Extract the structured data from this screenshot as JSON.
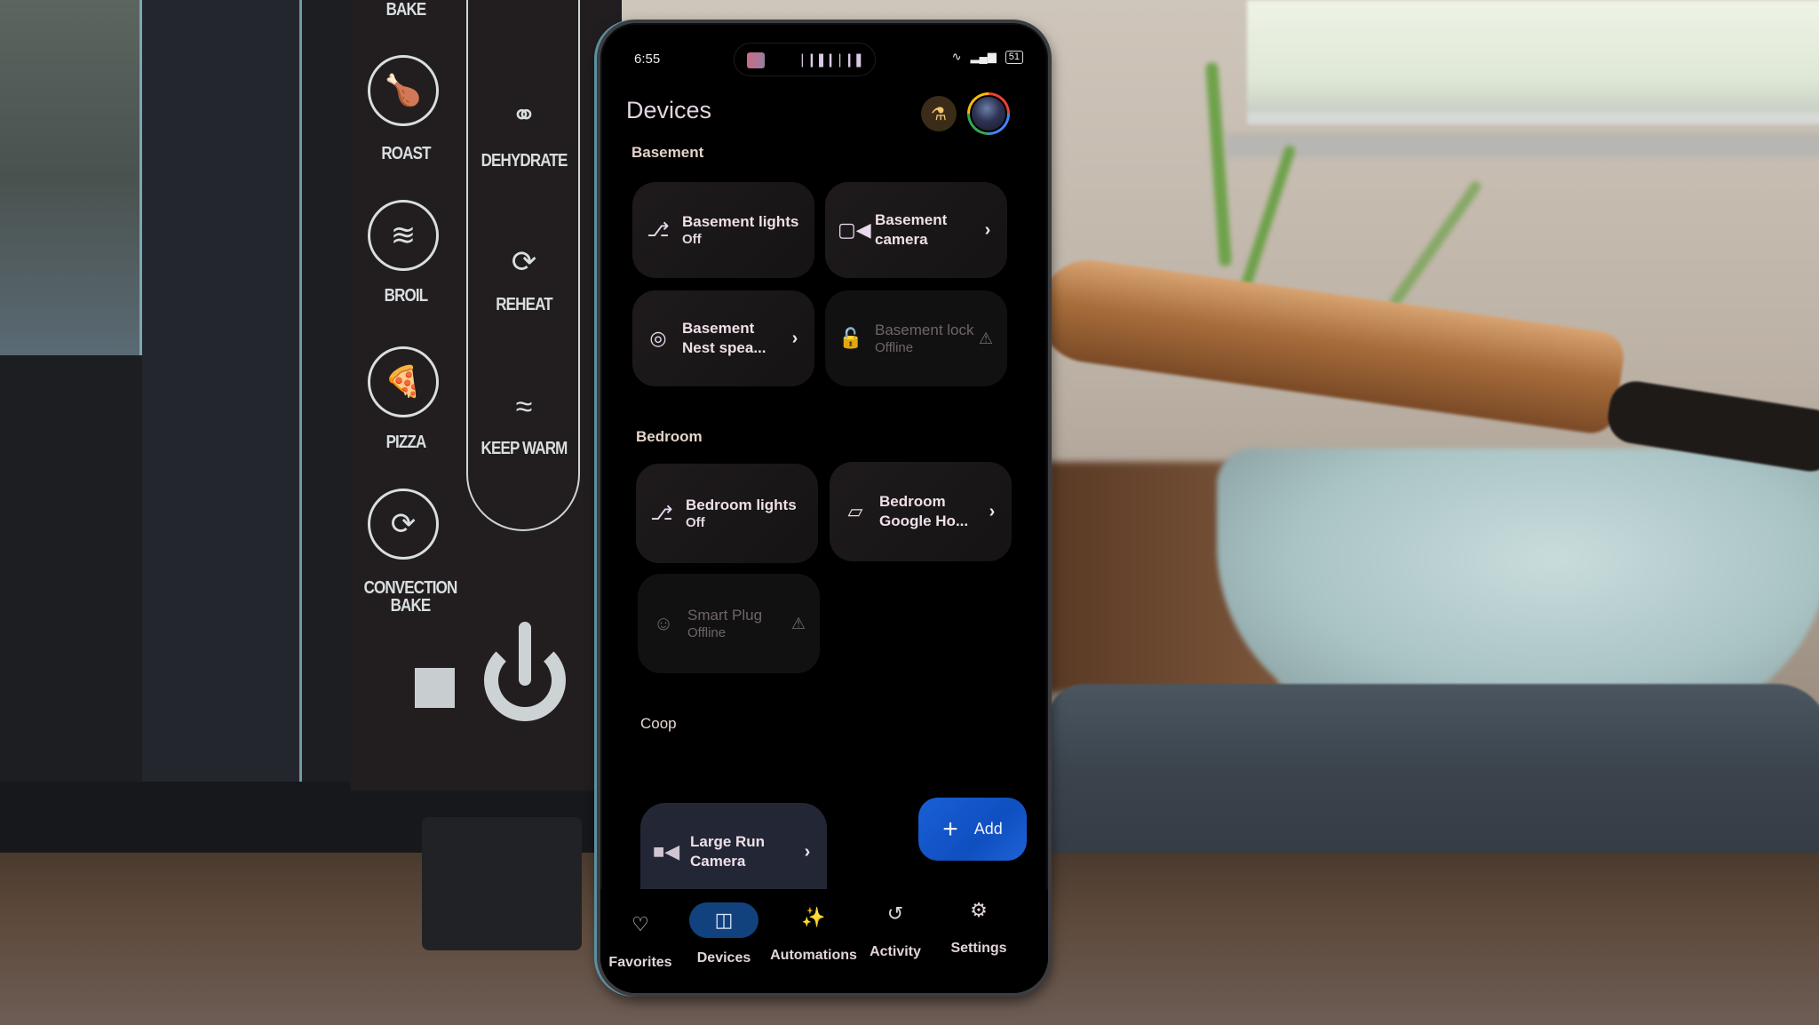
{
  "scene": {
    "oven_panel_labels": [
      "BAKE",
      "ROAST",
      "BROIL",
      "PIZZA",
      "CONVECTION BAKE",
      "DEHYDRATE",
      "REHEAT",
      "KEEP WARM"
    ]
  },
  "status_bar": {
    "time": "6:55",
    "battery": "51",
    "wifi_icon": "wifi-icon",
    "signal_icon": "signal-icon"
  },
  "header": {
    "title": "Devices",
    "labs_icon": "flask-icon",
    "avatar": "account-avatar"
  },
  "sections": [
    {
      "label": "Basement",
      "devices": [
        {
          "name": "Basement lights",
          "status": "Off",
          "icon": "lamp-icon",
          "offline": false,
          "chevron": false
        },
        {
          "name": "Basement camera",
          "status": "",
          "icon": "camera-icon",
          "offline": false,
          "chevron": true
        },
        {
          "name": "Basement Nest spea...",
          "status": "",
          "icon": "speaker-icon",
          "offline": false,
          "chevron": true
        },
        {
          "name": "Basement lock",
          "status": "Offline",
          "icon": "lock-icon",
          "offline": true,
          "chevron": false
        }
      ]
    },
    {
      "label": "Bedroom",
      "devices": [
        {
          "name": "Bedroom lights",
          "status": "Off",
          "icon": "lamp-icon",
          "offline": false,
          "chevron": false
        },
        {
          "name": "Bedroom Google Ho...",
          "status": "",
          "icon": "google-home-speaker-icon",
          "offline": false,
          "chevron": true
        },
        {
          "name": "Smart Plug",
          "status": "Offline",
          "icon": "outlet-icon",
          "offline": true,
          "chevron": false
        }
      ]
    },
    {
      "label": "Coop",
      "devices": [
        {
          "name": "Large Run Camera",
          "status": "",
          "icon": "camera-filled-icon",
          "offline": false,
          "chevron": true
        }
      ]
    }
  ],
  "add_button": {
    "label": "Add",
    "icon": "plus-icon"
  },
  "bottom_nav": [
    {
      "label": "Favorites",
      "icon": "heart-icon",
      "active": false
    },
    {
      "label": "Devices",
      "icon": "devices-icon",
      "active": true
    },
    {
      "label": "Automations",
      "icon": "sparkle-icon",
      "active": false
    },
    {
      "label": "Activity",
      "icon": "history-icon",
      "active": false
    },
    {
      "label": "Settings",
      "icon": "gear-icon",
      "active": false
    }
  ],
  "colors": {
    "accent_blue": "#1a5fd6",
    "nav_active_bg": "#12427d",
    "labs_yellow": "#f1c66d"
  }
}
